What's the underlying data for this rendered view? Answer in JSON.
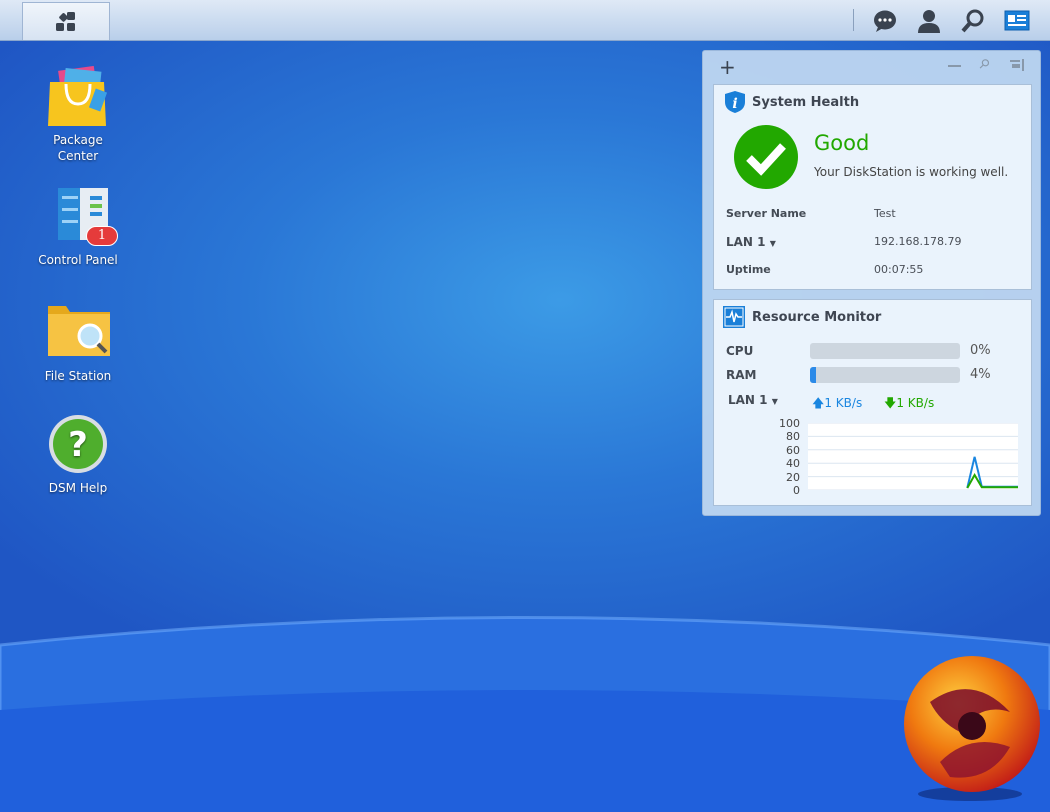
{
  "taskbar": {
    "main_menu": "main-menu",
    "icons": [
      "notifications-icon",
      "user-icon",
      "search-icon",
      "widgets-icon"
    ]
  },
  "desktop": {
    "icons": [
      {
        "label": "Package\nCenter",
        "line1": "Package",
        "line2": "Center"
      },
      {
        "label": "Control Panel",
        "badge": "1"
      },
      {
        "label": "File Station"
      },
      {
        "label": "DSM Help"
      }
    ]
  },
  "widgets": {
    "system_health": {
      "title": "System Health",
      "status": "Good",
      "message": "Your DiskStation is working well.",
      "rows": [
        {
          "label": "Server Name",
          "value": "Test"
        },
        {
          "label": "LAN 1",
          "value": "192.168.178.79"
        },
        {
          "label": "Uptime",
          "value": "00:07:55"
        }
      ]
    },
    "resource_monitor": {
      "title": "Resource Monitor",
      "cpu_label": "CPU",
      "cpu_percent": 0,
      "cpu_text": "0%",
      "ram_label": "RAM",
      "ram_percent": 4,
      "ram_text": "4%",
      "lan_label": "LAN 1",
      "upload": "1 KB/s",
      "download": "1 KB/s"
    }
  },
  "colors": {
    "good": "#22a800",
    "upload": "#1a86e0",
    "download": "#22a800"
  },
  "chart_data": {
    "type": "line",
    "yticks": [
      "100",
      "80",
      "60",
      "40",
      "20",
      "0"
    ],
    "ylim": [
      0,
      100
    ],
    "x": [
      0,
      1,
      2,
      3,
      4,
      5,
      6,
      7,
      8,
      9,
      10,
      11,
      12,
      13,
      14,
      15,
      16,
      17,
      18,
      19,
      20,
      21,
      22,
      23,
      24,
      25,
      26,
      27,
      28,
      29
    ],
    "series": [
      {
        "name": "upload",
        "values": [
          null,
          null,
          null,
          null,
          null,
          null,
          null,
          null,
          null,
          null,
          null,
          null,
          null,
          null,
          null,
          null,
          null,
          null,
          null,
          null,
          null,
          null,
          0,
          48,
          2,
          2,
          2,
          2,
          2,
          2
        ]
      },
      {
        "name": "download",
        "values": [
          null,
          null,
          null,
          null,
          null,
          null,
          null,
          null,
          null,
          null,
          null,
          null,
          null,
          null,
          null,
          null,
          null,
          null,
          null,
          null,
          null,
          null,
          0,
          20,
          1,
          1,
          1,
          1,
          1,
          1
        ]
      }
    ]
  }
}
